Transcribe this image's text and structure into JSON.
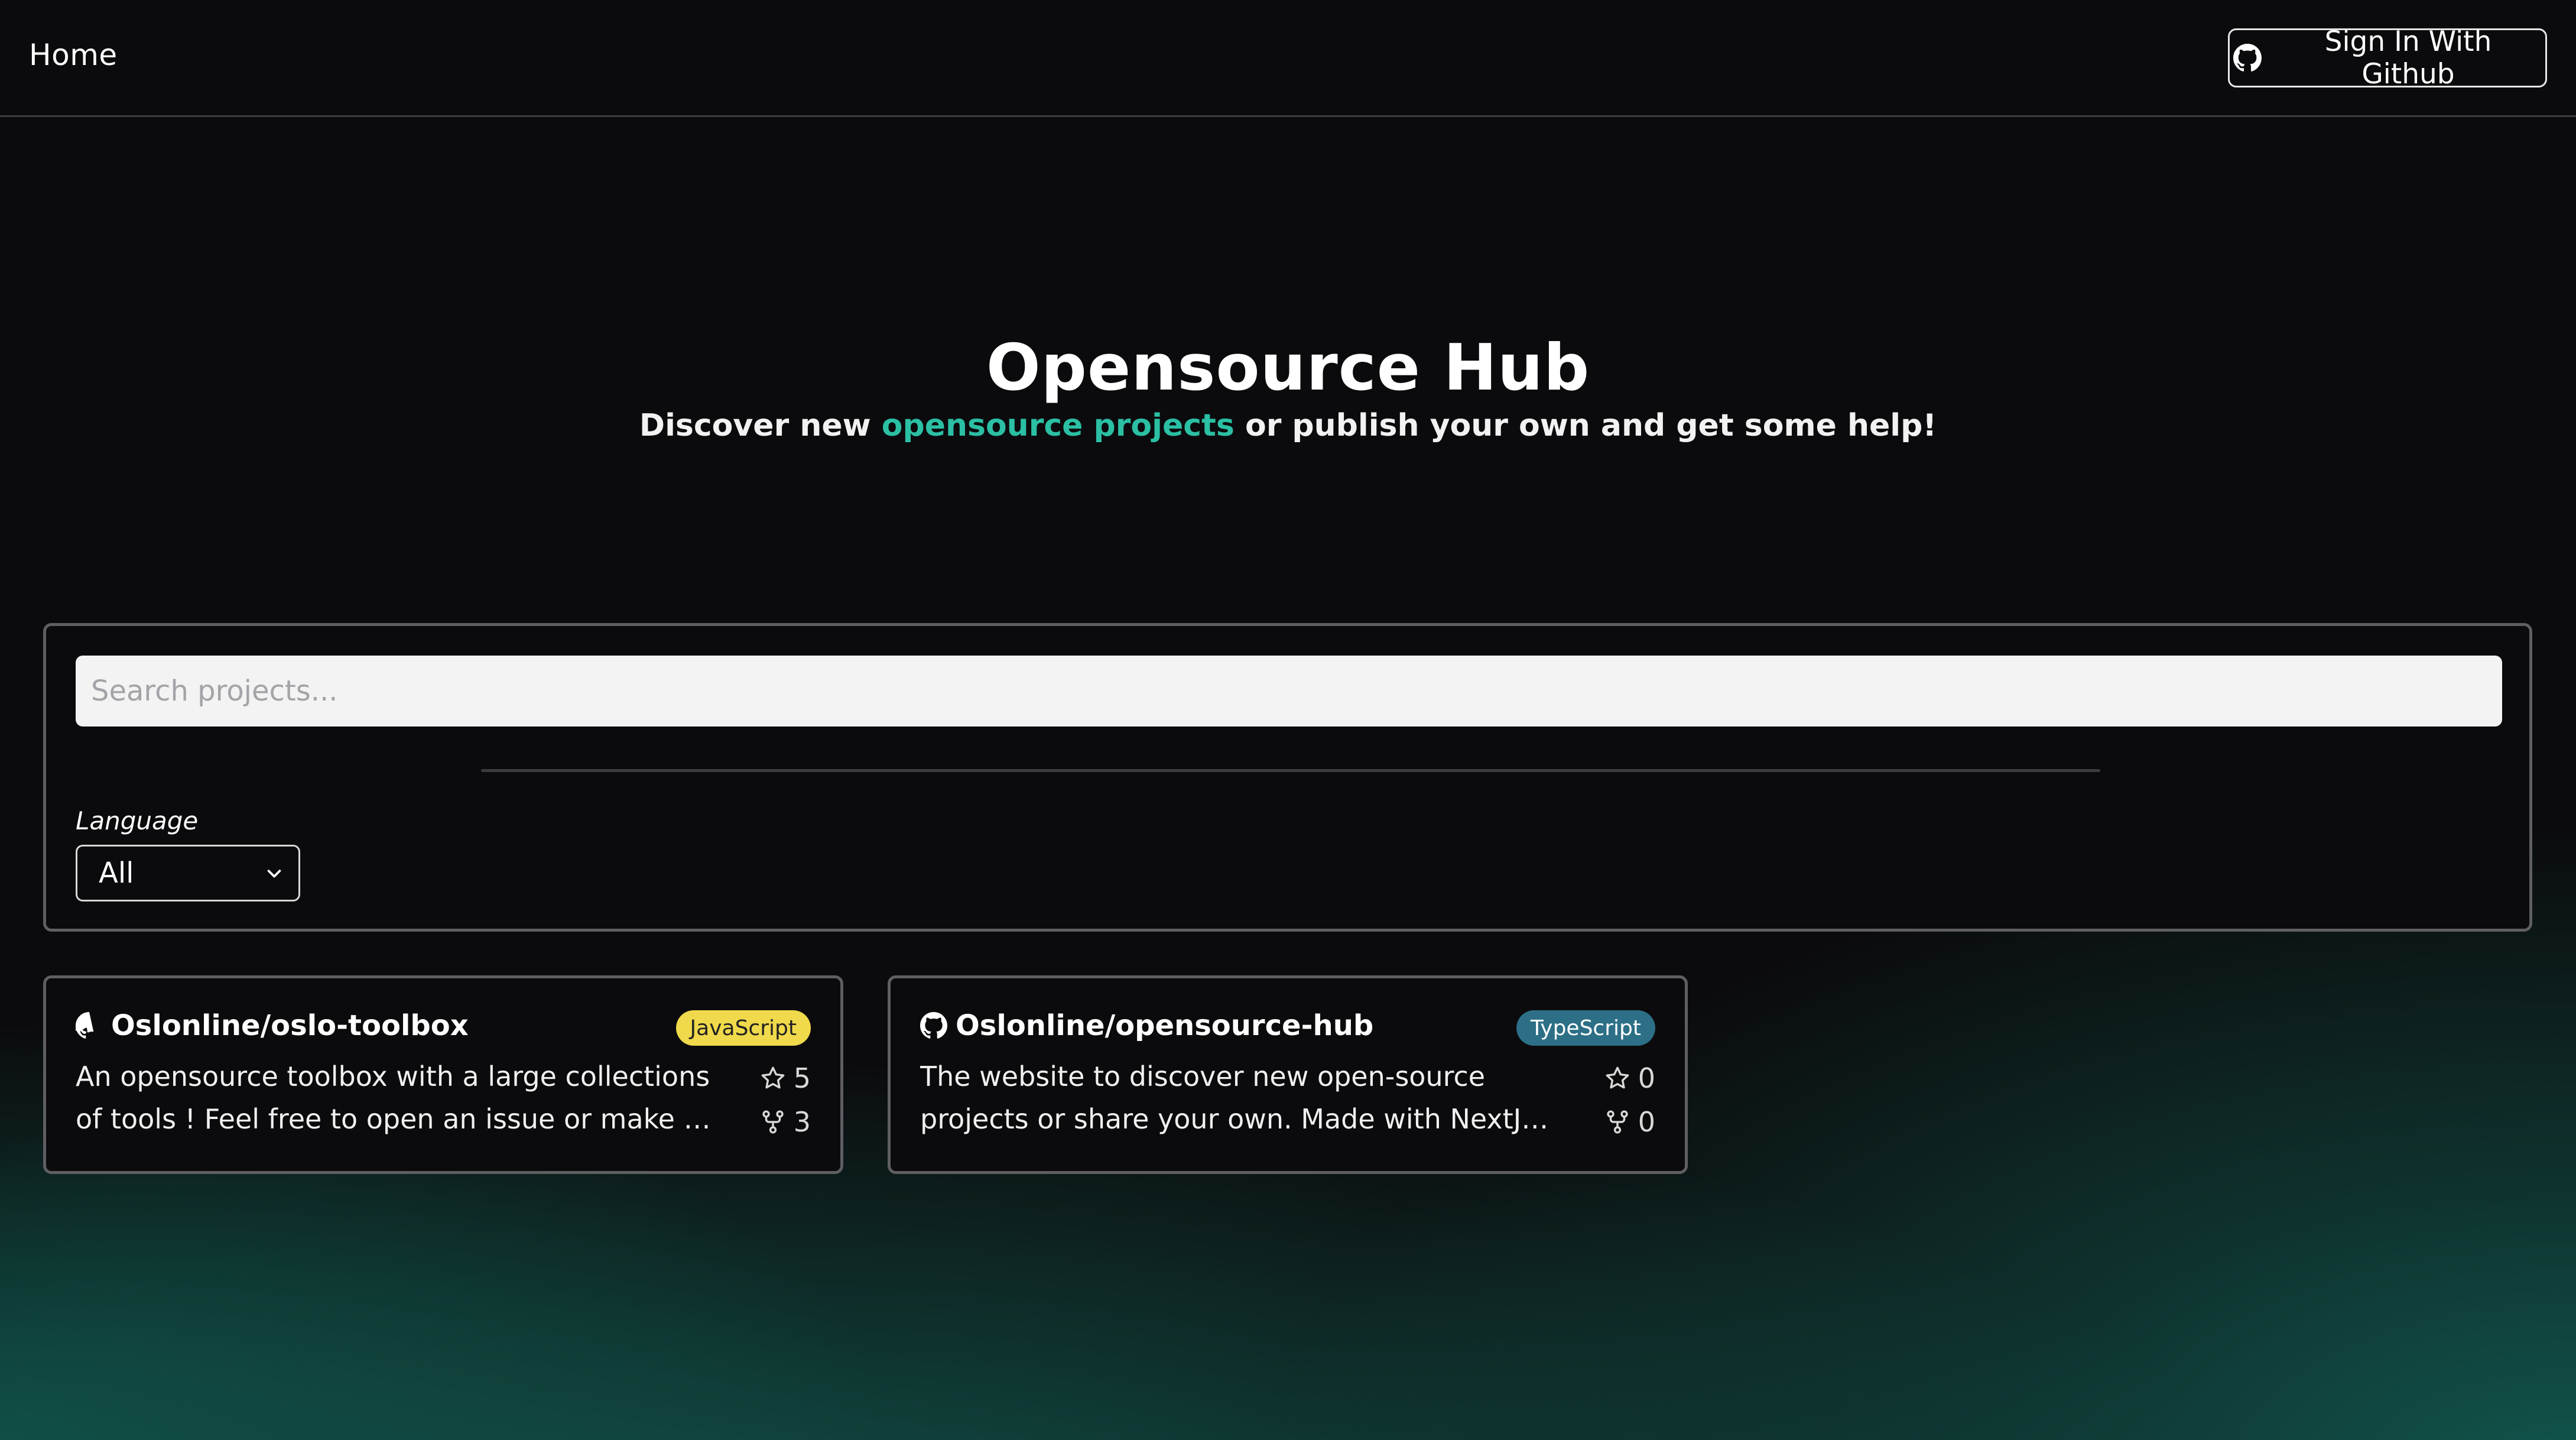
{
  "nav": {
    "home_label": "Home",
    "signin_label": "Sign In With Github"
  },
  "hero": {
    "title": "Opensource Hub",
    "subtitle_before": "Discover new ",
    "subtitle_accent": "opensource projects",
    "subtitle_after": " or publish your own and get some help!"
  },
  "search": {
    "placeholder": "Search projects...",
    "language_label": "Language",
    "language_selected": "All"
  },
  "projects": [
    {
      "name": "Oslonline/oslo-toolbox",
      "language": "JavaScript",
      "description": "An opensource toolbox with a large collections of tools ! Feel free to open an issue or make a pull...",
      "stars": "5",
      "forks": "3"
    },
    {
      "name": "Oslonline/opensource-hub",
      "language": "TypeScript",
      "description": "The website to discover new open-source projects or share your own. Made with NextJS, Typescript &...",
      "stars": "0",
      "forks": "0"
    }
  ],
  "colors": {
    "accent": "#2bbfa4",
    "javascript_badge": "#f0d94a",
    "typescript_badge": "#2c6f86",
    "background": "#0b0b0d"
  },
  "icons": [
    "github-icon",
    "star-icon",
    "fork-icon",
    "chevron-down-icon"
  ]
}
